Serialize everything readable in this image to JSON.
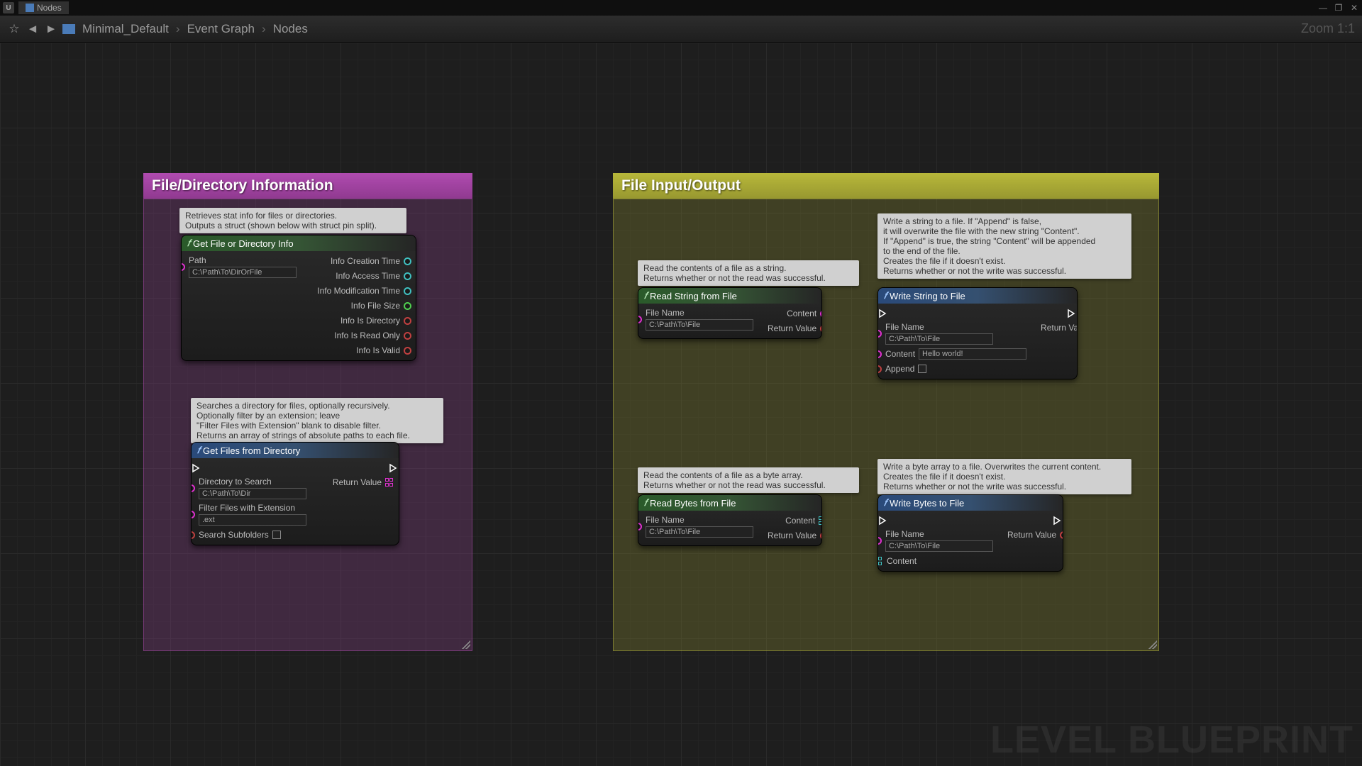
{
  "titlebar": {
    "tab_label": "Nodes"
  },
  "crumbs": {
    "a": "Minimal_Default",
    "b": "Event Graph",
    "c": "Nodes"
  },
  "zoom": "Zoom 1:1",
  "watermark": "LEVEL BLUEPRINT",
  "comment1": {
    "title": "File/Directory Information"
  },
  "comment2": {
    "title": "File Input/Output"
  },
  "note1": "Retrieves stat info for files or directories.\nOutputs a struct (shown below with struct pin split).",
  "note2": "Searches a directory for files, optionally recursively.\nOptionally filter by an extension; leave\n\"Filter Files with Extension\" blank to disable filter.\nReturns an array of strings of absolute paths to each file.",
  "note3": "Read the contents of a file as a string.\nReturns whether or not the read was successful.",
  "note4": "Read the contents of a file as a byte array.\nReturns whether or not the read was successful.",
  "note5": "Write a string to a file. If \"Append\" is false,\nit will overwrite the file with the new string \"Content\".\nIf \"Append\" is true, the string \"Content\" will be appended\nto the end of the file.\nCreates the file if it doesn't exist.\nReturns whether or not the write was successful.",
  "note6": "Write a byte array to a file. Overwrites the current content.\nCreates the file if it doesn't exist.\nReturns whether or not the write was successful.",
  "n1": {
    "title": "Get File or Directory Info",
    "in_path": "Path",
    "in_path_val": "C:\\Path\\To\\DirOrFile",
    "o1": "Info Creation Time",
    "o2": "Info Access Time",
    "o3": "Info Modification Time",
    "o4": "Info File Size",
    "o5": "Info Is Directory",
    "o6": "Info Is Read Only",
    "o7": "Info Is Valid"
  },
  "n2": {
    "title": "Get Files from Directory",
    "in_dir": "Directory to Search",
    "in_dir_val": "C:\\Path\\To\\Dir",
    "in_filter": "Filter Files with Extension",
    "in_filter_val": ".ext",
    "in_sub": "Search Subfolders",
    "out_ret": "Return Value"
  },
  "n3": {
    "title": "Read String from File",
    "in_file": "File Name",
    "in_file_val": "C:\\Path\\To\\File",
    "out_content": "Content",
    "out_ret": "Return Value"
  },
  "n4": {
    "title": "Read Bytes from File",
    "in_file": "File Name",
    "in_file_val": "C:\\Path\\To\\File",
    "out_content": "Content",
    "out_ret": "Return Value"
  },
  "n5": {
    "title": "Write String to File",
    "in_file": "File Name",
    "in_file_val": "C:\\Path\\To\\File",
    "in_content": "Content",
    "in_content_val": "Hello world!",
    "in_append": "Append",
    "out_ret": "Return Value"
  },
  "n6": {
    "title": "Write Bytes to File",
    "in_file": "File Name",
    "in_file_val": "C:\\Path\\To\\File",
    "in_content": "Content",
    "out_ret": "Return Value"
  }
}
